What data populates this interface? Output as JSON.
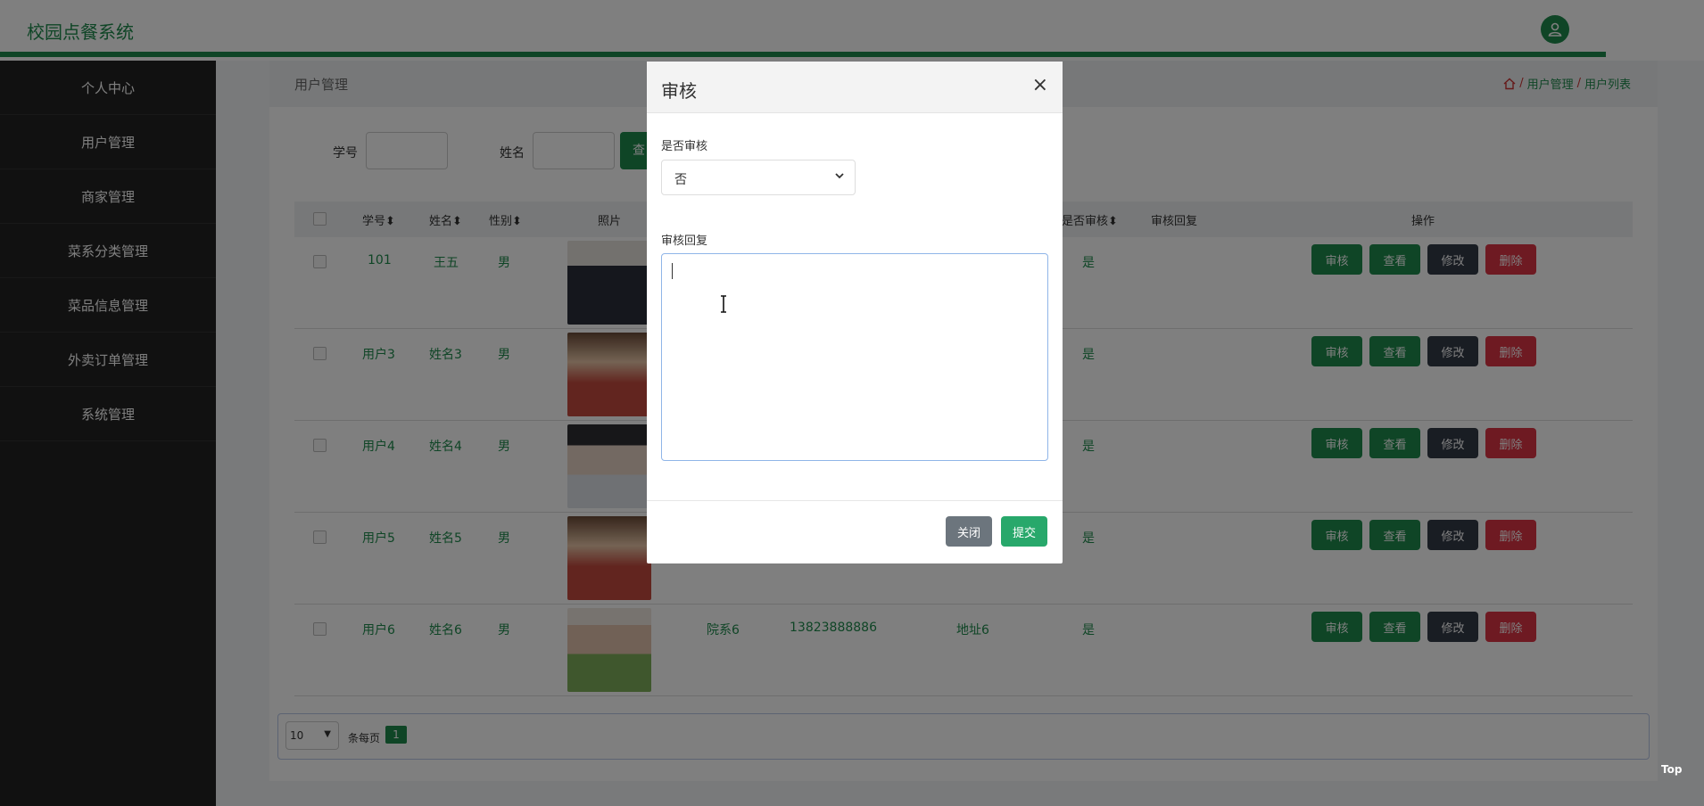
{
  "app": {
    "title": "校园点餐系统"
  },
  "sidebar": {
    "items": [
      {
        "label": "个人中心"
      },
      {
        "label": "用户管理"
      },
      {
        "label": "商家管理"
      },
      {
        "label": "菜系分类管理"
      },
      {
        "label": "菜品信息管理"
      },
      {
        "label": "外卖订单管理"
      },
      {
        "label": "系统管理"
      }
    ]
  },
  "page": {
    "title": "用户管理",
    "breadcrumb": [
      "用户管理",
      "用户列表"
    ]
  },
  "search": {
    "fields": [
      {
        "label": "学号",
        "value": ""
      },
      {
        "label": "姓名",
        "value": ""
      }
    ],
    "button_label": "查"
  },
  "table": {
    "headers": [
      "学号",
      "姓名",
      "性别",
      "照片",
      "是否审核",
      "审核回复",
      "操作"
    ],
    "rows": [
      {
        "id": "101",
        "name": "王五",
        "gender": "男",
        "dept": "",
        "phone": "",
        "address": "",
        "audited": "是",
        "reply": "",
        "photo_colors": [
          "#2b2f3a",
          "#e7e2dc"
        ]
      },
      {
        "id": "用户3",
        "name": "姓名3",
        "gender": "男",
        "dept": "",
        "phone": "",
        "address": "",
        "audited": "是",
        "reply": "",
        "photo_colors": [
          "#c44a3e",
          "#e9c7a8"
        ]
      },
      {
        "id": "用户4",
        "name": "姓名4",
        "gender": "男",
        "dept": "",
        "phone": "",
        "address": "",
        "audited": "是",
        "reply": "",
        "photo_colors": [
          "#dfe3e8",
          "#6f7a87"
        ]
      },
      {
        "id": "用户5",
        "name": "姓名5",
        "gender": "男",
        "dept": "",
        "phone": "",
        "address": "",
        "audited": "是",
        "reply": "",
        "photo_colors": [
          "#c44a3e",
          "#e9c7a8"
        ]
      },
      {
        "id": "用户6",
        "name": "姓名6",
        "gender": "男",
        "dept": "院系6",
        "phone": "13823888886",
        "address": "地址6",
        "audited": "是",
        "reply": "",
        "photo_colors": [
          "#7fae5a",
          "#efe7df"
        ]
      }
    ],
    "row_actions": {
      "audit": "审核",
      "view": "查看",
      "edit": "修改",
      "delete": "删除"
    }
  },
  "pagination": {
    "page_size": "10",
    "per_page_label": "条每页",
    "current_page": "1"
  },
  "back_to_top": "Top",
  "modal": {
    "title": "审核",
    "close_symbol": "×",
    "audit_label": "是否审核",
    "audit_value": "否",
    "reply_label": "审核回复",
    "reply_value": "",
    "close_button": "关闭",
    "submit_button": "提交"
  }
}
